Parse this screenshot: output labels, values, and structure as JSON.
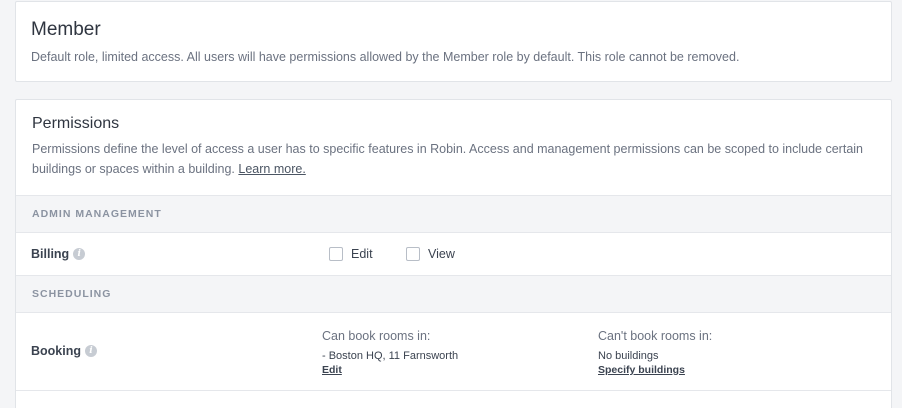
{
  "role": {
    "title": "Member",
    "description": "Default role, limited access. All users will have permissions allowed by the Member role by default. This role cannot be removed."
  },
  "permissions": {
    "title": "Permissions",
    "description": "Permissions define the level of access a user has to specific features in Robin. Access and management permissions can be scoped to include certain buildings or spaces within a building.",
    "learn_more": "Learn more."
  },
  "sections": [
    {
      "header": "ADMIN MANAGEMENT",
      "rows": [
        {
          "label": "Billing",
          "options": [
            {
              "label": "Edit",
              "checked": false
            },
            {
              "label": "View",
              "checked": false
            }
          ]
        }
      ]
    },
    {
      "header": "SCHEDULING",
      "rows": [
        {
          "label": "Booking",
          "can": {
            "title": "Can book rooms in:",
            "value": "- Boston HQ, 11 Farnsworth",
            "link": "Edit"
          },
          "cannot": {
            "title": "Can't book rooms in:",
            "value": "No buildings",
            "link": "Specify buildings"
          }
        }
      ]
    }
  ],
  "icons": {
    "info": "info-icon"
  },
  "colors": {
    "background": "#f4f5f7",
    "section_header_text": "#8b93a1",
    "body_text": "#3b4350"
  }
}
